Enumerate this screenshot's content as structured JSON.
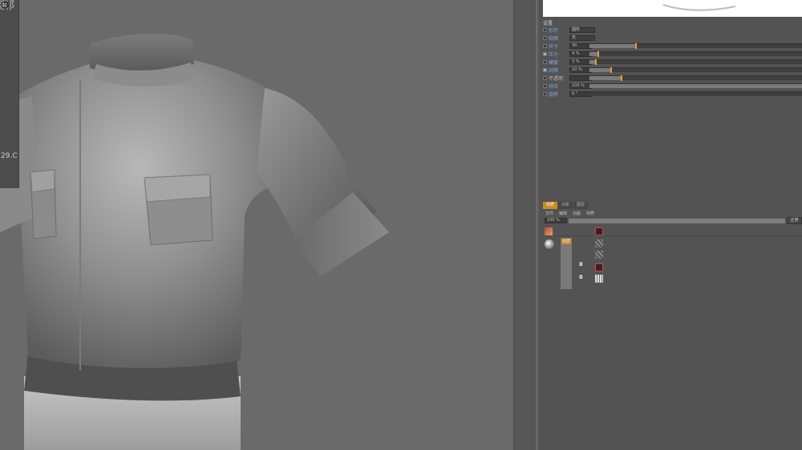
{
  "viewport": {
    "floating_panel_title": "素阝",
    "floating_panel_label": "29.C"
  },
  "preview": {},
  "settings": {
    "title": "设置",
    "rows": [
      {
        "label": "形状",
        "value": "圆形",
        "kind": "dropdown",
        "checkbox": false
      },
      {
        "label": "贴图",
        "value": "无",
        "kind": "dropdown",
        "checkbox": false
      },
      {
        "label": "尺寸",
        "value": "30",
        "kind": "slider",
        "fill": 0.22,
        "checkbox": false
      },
      {
        "label": "压力",
        "value": "4 %",
        "kind": "slider",
        "fill": 0.04,
        "checkbox": true
      },
      {
        "label": "硬度",
        "value": "3 %",
        "kind": "slider",
        "fill": 0.03,
        "checkbox": false
      },
      {
        "label": "间隔",
        "value": "10 %",
        "kind": "slider",
        "fill": 0.1,
        "checkbox": true
      },
      {
        "label": "不透明",
        "value": "",
        "kind": "slider",
        "fill": 0.15,
        "checkbox": false,
        "dim": true
      },
      {
        "label": "挤压",
        "value": "100 %",
        "kind": "slider",
        "fill": 1.0,
        "checkbox": false
      },
      {
        "label": "旋转",
        "value": "0 °",
        "kind": "slider",
        "fill": 0.0,
        "checkbox": false
      }
    ]
  },
  "layers_panel": {
    "tabs": [
      "材质",
      "对象",
      "图层"
    ],
    "menu": [
      "文件",
      "编辑",
      "功能",
      "材质"
    ],
    "zoom_value": "100 %",
    "zoom_button": "正常",
    "layer_tag": "材质"
  },
  "colors": {
    "accent": "#c88a22",
    "knob": "#e0a030",
    "label_blue": "#7fa6dd"
  }
}
